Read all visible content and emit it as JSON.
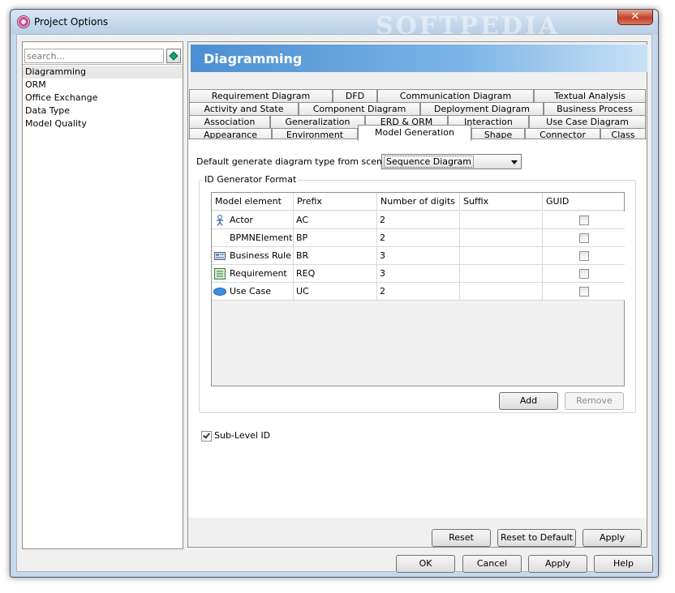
{
  "window": {
    "title": "Project Options",
    "watermark": "SOFTPEDIA",
    "close_glyph": "✕"
  },
  "sidebar": {
    "search_placeholder": "search...",
    "items": [
      {
        "label": "Diagramming",
        "selected": true
      },
      {
        "label": "ORM",
        "selected": false
      },
      {
        "label": "Office Exchange",
        "selected": false
      },
      {
        "label": "Data Type",
        "selected": false
      },
      {
        "label": "Model Quality",
        "selected": false
      }
    ]
  },
  "header": {
    "title": "Diagramming"
  },
  "tabs": {
    "row1": [
      "Requirement Diagram",
      "DFD",
      "Communication Diagram",
      "Textual Analysis"
    ],
    "row2": [
      "Activity and State",
      "Component Diagram",
      "Deployment Diagram",
      "Business Process"
    ],
    "row3": [
      "Association",
      "Generalization",
      "ERD & ORM",
      "Interaction",
      "Use Case Diagram"
    ],
    "row4": [
      "Appearance",
      "Environment",
      "Model Generation",
      "Shape",
      "Connector",
      "Class"
    ],
    "active": "Model Generation"
  },
  "model_generation": {
    "scenario_label": "Default generate diagram type from scenario :",
    "scenario_value": "Sequence Diagram",
    "group_title": "ID Generator Format",
    "columns": [
      "Model element",
      "Prefix",
      "Number of digits",
      "Suffix",
      "GUID"
    ],
    "rows": [
      {
        "element": "Actor",
        "icon": "actor-icon",
        "prefix": "AC",
        "digits": "2",
        "suffix": "",
        "guid": false
      },
      {
        "element": "BPMNElement",
        "icon": "",
        "prefix": "BP",
        "digits": "2",
        "suffix": "",
        "guid": false
      },
      {
        "element": "Business Rule",
        "icon": "business-rule-icon",
        "prefix": "BR",
        "digits": "3",
        "suffix": "",
        "guid": false
      },
      {
        "element": "Requirement",
        "icon": "requirement-icon",
        "prefix": "REQ",
        "digits": "3",
        "suffix": "",
        "guid": false
      },
      {
        "element": "Use Case",
        "icon": "use-case-icon",
        "prefix": "UC",
        "digits": "2",
        "suffix": "",
        "guid": false
      }
    ],
    "add_label": "Add",
    "remove_label": "Remove",
    "sublevel_label": "Sub-Level ID",
    "sublevel_checked": true
  },
  "panel_buttons": {
    "reset": "Reset",
    "reset_default": "Reset to Default",
    "apply": "Apply"
  },
  "dialog_buttons": {
    "ok": "OK",
    "cancel": "Cancel",
    "apply": "Apply",
    "help": "Help"
  }
}
